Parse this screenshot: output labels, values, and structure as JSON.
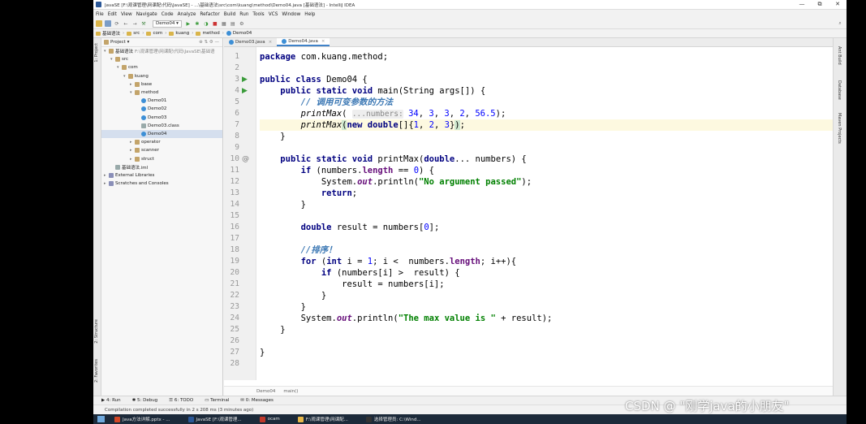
{
  "window": {
    "title": "JavaSE [F:\\观课管理\\网课配\\代码\\JavaSE] - ...\\基础语法\\src\\com\\kuang\\method\\Demo04.java [基础语法] - IntelliJ IDEA",
    "controls": [
      "—",
      "⧉",
      "✕"
    ]
  },
  "menu": [
    "File",
    "Edit",
    "View",
    "Navigate",
    "Code",
    "Analyze",
    "Refactor",
    "Build",
    "Run",
    "Tools",
    "VCS",
    "Window",
    "Help"
  ],
  "toolbar": {
    "run_config": "Demo04 ▾"
  },
  "nav_breadcrumb": [
    "基础语法",
    "src",
    "com",
    "kuang",
    "method",
    "Demo04"
  ],
  "project_panel": {
    "title": "Project ▾",
    "tree": [
      {
        "label": "基础语法",
        "extra": "F:\\观课管理\\网课配\\代码\\JavaSE\\基础语",
        "depth": 0,
        "arrow": "▾",
        "icon": "pkg"
      },
      {
        "label": "src",
        "extra": "",
        "depth": 1,
        "arrow": "▾",
        "icon": "pkg"
      },
      {
        "label": "com",
        "extra": "",
        "depth": 2,
        "arrow": "▾",
        "icon": "pkg"
      },
      {
        "label": "kuang",
        "extra": "",
        "depth": 3,
        "arrow": "▾",
        "icon": "pkg"
      },
      {
        "label": "base",
        "extra": "",
        "depth": 4,
        "arrow": "▸",
        "icon": "pkg"
      },
      {
        "label": "method",
        "extra": "",
        "depth": 4,
        "arrow": "▾",
        "icon": "pkg"
      },
      {
        "label": "Demo01",
        "extra": "",
        "depth": 5,
        "arrow": "",
        "icon": "cls"
      },
      {
        "label": "Demo02",
        "extra": "",
        "depth": 5,
        "arrow": "",
        "icon": "cls"
      },
      {
        "label": "Demo03",
        "extra": "",
        "depth": 5,
        "arrow": "",
        "icon": "cls"
      },
      {
        "label": "Demo03.class",
        "extra": "",
        "depth": 5,
        "arrow": "",
        "icon": "file"
      },
      {
        "label": "Demo04",
        "extra": "",
        "depth": 5,
        "arrow": "",
        "icon": "cls",
        "selected": true
      },
      {
        "label": "operator",
        "extra": "",
        "depth": 4,
        "arrow": "▸",
        "icon": "pkg"
      },
      {
        "label": "scanner",
        "extra": "",
        "depth": 4,
        "arrow": "▸",
        "icon": "pkg"
      },
      {
        "label": "struct",
        "extra": "",
        "depth": 4,
        "arrow": "▸",
        "icon": "pkg"
      },
      {
        "label": "基础语法.iml",
        "extra": "",
        "depth": 1,
        "arrow": "",
        "icon": "file"
      },
      {
        "label": "External Libraries",
        "extra": "",
        "depth": 0,
        "arrow": "▸",
        "icon": "lib"
      },
      {
        "label": "Scratches and Consoles",
        "extra": "",
        "depth": 0,
        "arrow": "▸",
        "icon": "lib"
      }
    ]
  },
  "editor": {
    "tabs": [
      {
        "label": "Demo03.java",
        "active": false
      },
      {
        "label": "Demo04.java",
        "active": true
      }
    ],
    "line_numbers": [
      "1",
      "2",
      "3",
      "4",
      "5",
      "6",
      "7",
      "8",
      "9",
      "10",
      "11",
      "12",
      "13",
      "14",
      "15",
      "16",
      "17",
      "18",
      "19",
      "20",
      "21",
      "22",
      "23",
      "24",
      "25",
      "26",
      "27",
      "28"
    ],
    "gutter_marks": {
      "3": "run",
      "4": "run",
      "10": "at"
    },
    "highlighted_line": 7,
    "breadcrumb": [
      "Demo04",
      "main()"
    ]
  },
  "left_strip": [
    "1: Project",
    "2: Structure",
    "2: Favorites"
  ],
  "right_strip": [
    "Ant Build",
    "Database",
    "Maven Projects"
  ],
  "bottom_tools": [
    "▶ 4: Run",
    "✱ 5: Debug",
    "☰ 6: TODO",
    "▭ Terminal",
    "✉ 0: Messages"
  ],
  "status": {
    "text": "Compilation completed successfully in 2 s 208 ms (3 minutes ago)"
  },
  "taskbar": [
    {
      "label": "Java方法详解.pptx - ...",
      "color": "#d24726"
    },
    {
      "label": "JavaSE [F:\\观课管理...",
      "color": "#2b5797"
    },
    {
      "label": "ocam",
      "color": "#c0392b"
    },
    {
      "label": "F:\\观课管理\\网课配...",
      "color": "#e8b84a"
    },
    {
      "label": "选择管理员: C:\\Wind...",
      "color": "#333"
    }
  ],
  "watermark": "CSDN @ \"刚学java的小朋友\"",
  "colors": {
    "keyword": "#000080",
    "string": "#008000",
    "number": "#0000ff",
    "comment": "#808080",
    "field": "#660e7a",
    "selection": "#d5dfee"
  }
}
